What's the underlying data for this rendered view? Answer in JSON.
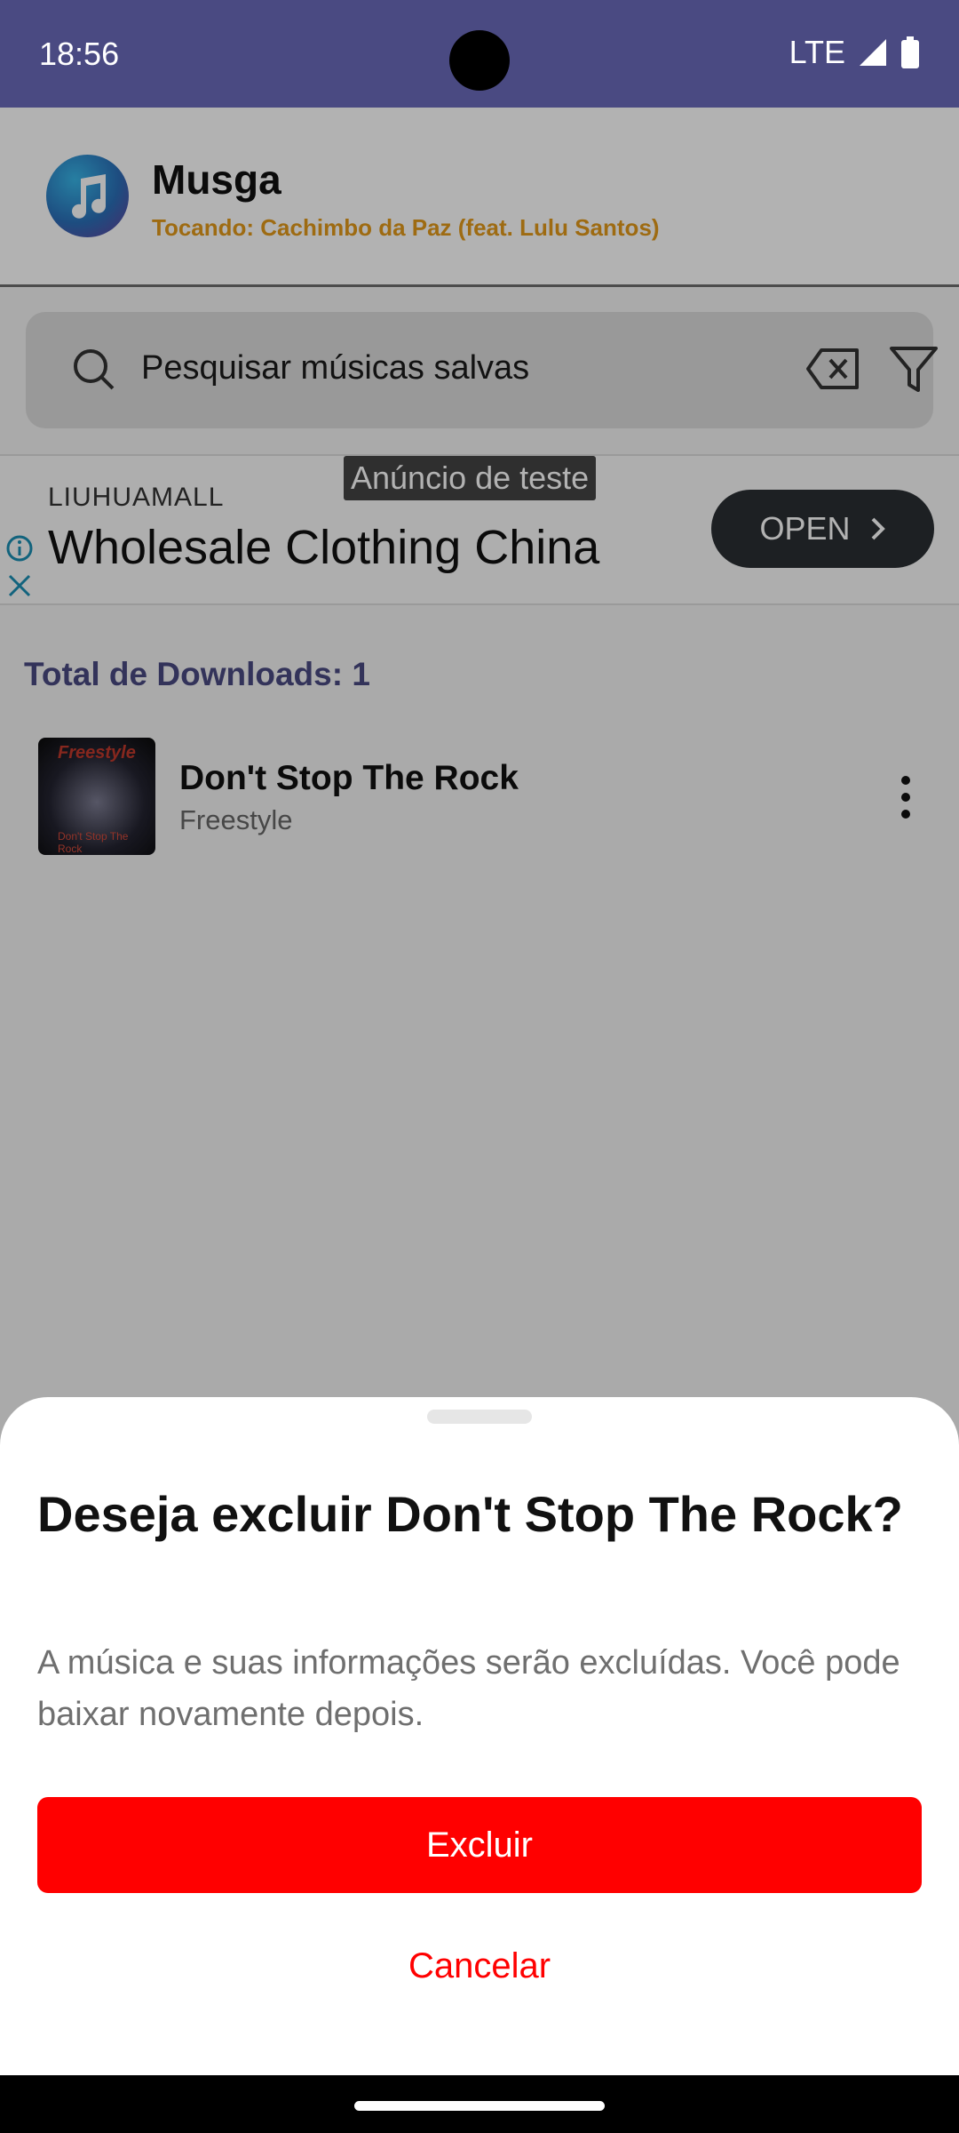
{
  "status_bar": {
    "time": "18:56",
    "network": "LTE"
  },
  "header": {
    "app_name": "Musga",
    "now_playing": "Tocando: Cachimbo da Paz (feat. Lulu Santos)"
  },
  "search": {
    "placeholder": "Pesquisar músicas salvas"
  },
  "ad": {
    "label": "Anúncio de teste",
    "brand": "LIUHUAMALL",
    "headline": "Wholesale Clothing China",
    "cta": "OPEN"
  },
  "downloads": {
    "total_label": "Total de Downloads: 1"
  },
  "songs": [
    {
      "title": "Don't Stop The Rock",
      "artist": "Freestyle",
      "thumb_top": "Freestyle",
      "thumb_bottom": "Don't Stop The Rock"
    }
  ],
  "dialog": {
    "title": "Deseja excluir Don't Stop The Rock?",
    "message": "A música e suas informações serão excluídas. Você pode baixar novamente depois.",
    "confirm_label": "Excluir",
    "cancel_label": "Cancelar"
  },
  "colors": {
    "status_bar": "#4a4a82",
    "accent_orange": "#e39a1b",
    "danger": "#ff0000"
  }
}
